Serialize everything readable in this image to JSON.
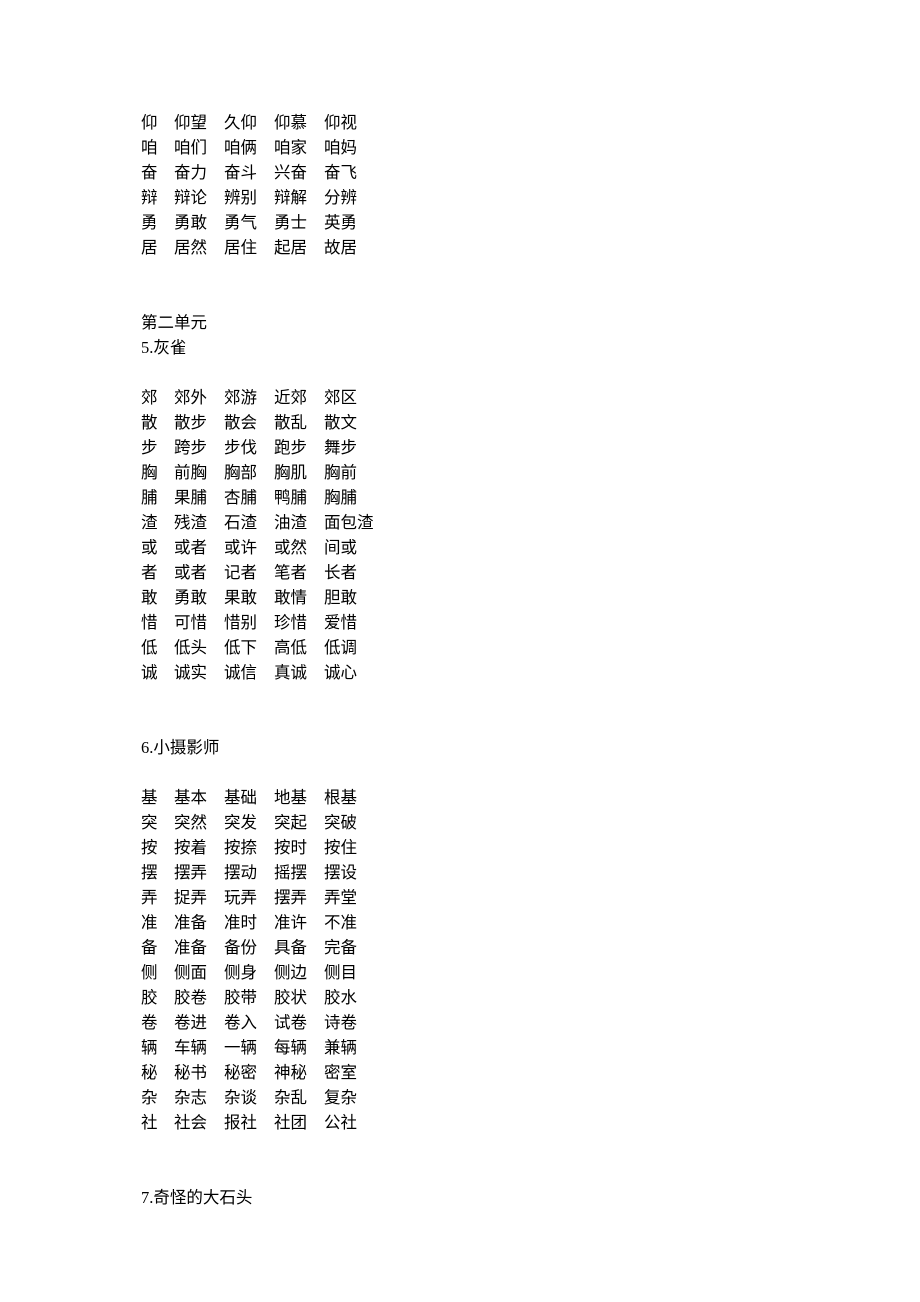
{
  "sections": [
    {
      "heading": null,
      "subheading": null,
      "rows": [
        {
          "key": "仰",
          "words": [
            "仰望",
            "久仰",
            "仰慕",
            "仰视"
          ]
        },
        {
          "key": "咱",
          "words": [
            "咱们",
            "咱俩",
            "咱家",
            "咱妈"
          ]
        },
        {
          "key": "奋",
          "words": [
            "奋力",
            "奋斗",
            "兴奋",
            "奋飞"
          ]
        },
        {
          "key": "辩",
          "words": [
            "辩论",
            "辨别",
            "辩解",
            "分辨"
          ]
        },
        {
          "key": "勇",
          "words": [
            "勇敢",
            "勇气",
            "勇士",
            "英勇"
          ]
        },
        {
          "key": "居",
          "words": [
            "居然",
            "居住",
            "起居",
            "故居"
          ]
        }
      ]
    },
    {
      "heading": "第二单元",
      "subheading": "5.灰雀",
      "rows": [
        {
          "key": "郊",
          "words": [
            "郊外",
            "郊游",
            "近郊",
            "郊区"
          ]
        },
        {
          "key": "散",
          "words": [
            "散步",
            "散会",
            "散乱",
            "散文"
          ]
        },
        {
          "key": "步",
          "words": [
            "跨步",
            "步伐",
            "跑步",
            "舞步"
          ]
        },
        {
          "key": "胸",
          "words": [
            "前胸",
            "胸部",
            "胸肌",
            "胸前"
          ]
        },
        {
          "key": "脯",
          "words": [
            "果脯",
            "杏脯",
            "鸭脯",
            "胸脯"
          ]
        },
        {
          "key": "渣",
          "words": [
            "残渣",
            "石渣",
            "油渣",
            "面包渣"
          ]
        },
        {
          "key": "或",
          "words": [
            "或者",
            "或许",
            "或然",
            "间或"
          ]
        },
        {
          "key": "者",
          "words": [
            "或者",
            "记者",
            "笔者",
            "长者"
          ]
        },
        {
          "key": "敢",
          "words": [
            "勇敢",
            "果敢",
            "敢情",
            "胆敢"
          ]
        },
        {
          "key": "惜",
          "words": [
            "可惜",
            "惜别",
            "珍惜",
            "爱惜"
          ]
        },
        {
          "key": "低",
          "words": [
            "低头",
            "低下",
            "高低",
            "低调"
          ]
        },
        {
          "key": "诚",
          "words": [
            "诚实",
            "诚信",
            "真诚",
            "诚心"
          ]
        }
      ]
    },
    {
      "heading": null,
      "subheading": "6.小摄影师",
      "rows": [
        {
          "key": "基",
          "words": [
            "基本",
            "基础",
            "地基",
            "根基"
          ]
        },
        {
          "key": "突",
          "words": [
            "突然",
            "突发",
            "突起",
            "突破"
          ]
        },
        {
          "key": "按",
          "words": [
            "按着",
            "按捺",
            "按时",
            "按住"
          ]
        },
        {
          "key": "摆",
          "words": [
            "摆弄",
            "摆动",
            "摇摆",
            "摆设"
          ]
        },
        {
          "key": "弄",
          "words": [
            "捉弄",
            "玩弄",
            "摆弄",
            "弄堂"
          ]
        },
        {
          "key": "准",
          "words": [
            "准备",
            "准时",
            "准许",
            "不准"
          ]
        },
        {
          "key": "备",
          "words": [
            "准备",
            "备份",
            "具备",
            "完备"
          ]
        },
        {
          "key": "侧",
          "words": [
            "侧面",
            "侧身",
            "侧边",
            "侧目"
          ]
        },
        {
          "key": "胶",
          "words": [
            "胶卷",
            "胶带",
            "胶状",
            "胶水"
          ]
        },
        {
          "key": "卷",
          "words": [
            "卷进",
            "卷入",
            "试卷",
            "诗卷"
          ]
        },
        {
          "key": "辆",
          "words": [
            "车辆",
            "一辆",
            "每辆",
            "兼辆"
          ]
        },
        {
          "key": "秘",
          "words": [
            "秘书",
            "秘密",
            "神秘",
            "密室"
          ]
        },
        {
          "key": "杂",
          "words": [
            "杂志",
            "杂谈",
            "杂乱",
            "复杂"
          ]
        },
        {
          "key": "社",
          "words": [
            "社会",
            "报社",
            "社团",
            "公社"
          ]
        }
      ]
    },
    {
      "heading": null,
      "subheading": "7.奇怪的大石头",
      "rows": []
    }
  ]
}
